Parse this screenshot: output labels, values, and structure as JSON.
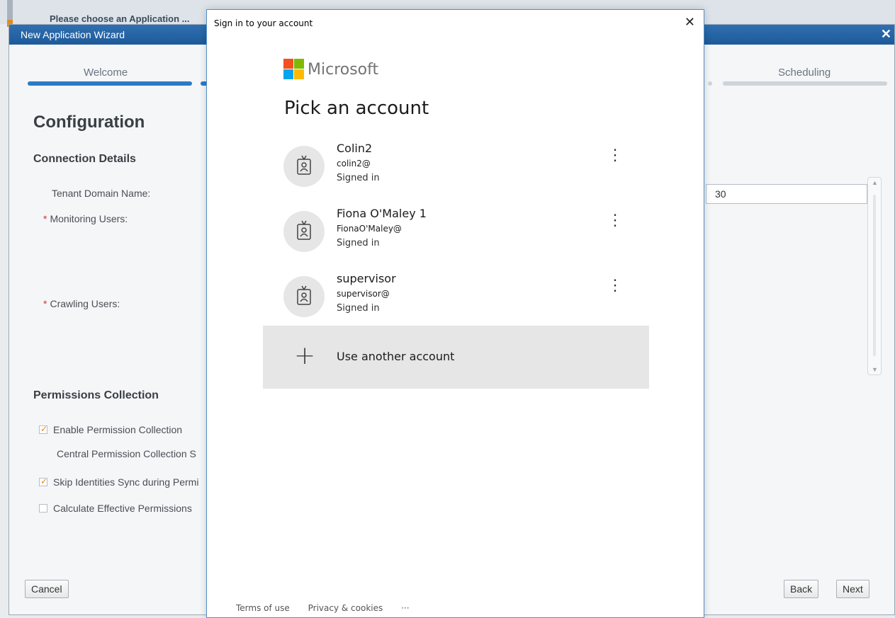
{
  "background": {
    "header_text": "Please choose an Application ..."
  },
  "wizard": {
    "title": "New Application Wizard",
    "close_glyph": "✕",
    "steps": {
      "welcome": "Welcome",
      "scheduling": "Scheduling"
    },
    "config_title": "Configuration",
    "connection_details": "Connection Details",
    "tenant_label": "Tenant Domain Name:",
    "monitoring_label": "Monitoring Users:",
    "crawling_label": "Crawling Users:",
    "required_mark": "*",
    "number_value": "30",
    "permissions_title": "Permissions Collection",
    "enable_permission": "Enable Permission Collection",
    "central_permission": "Central Permission Collection S",
    "skip_identities": "Skip Identities Sync during Permi",
    "calc_effective": "Calculate Effective Permissions",
    "cancel": "Cancel",
    "back": "Back",
    "next": "Next"
  },
  "signin": {
    "title": "Sign in to your account",
    "close_glyph": "✕",
    "brand": "Microsoft",
    "heading": "Pick an account",
    "accounts": [
      {
        "name": "Colin2",
        "email": "colin2@",
        "status": "Signed in"
      },
      {
        "name": "Fiona O'Maley 1",
        "email": "FionaO'Maley@",
        "status": "Signed in"
      },
      {
        "name": "supervisor",
        "email": "supervisor@",
        "status": "Signed in"
      }
    ],
    "more_glyph": "⋮",
    "use_another": "Use another account",
    "plus_glyph": "+",
    "terms": "Terms of use",
    "privacy": "Privacy & cookies",
    "ellipsis": "···"
  },
  "colors": {
    "titlebar": "#1e5a99",
    "progress_blue": "#2a7cc7",
    "ms_red": "#f25022",
    "ms_green": "#7fba00",
    "ms_blue": "#00a4ef",
    "ms_yellow": "#ffb900"
  },
  "icons": [
    "close-icon",
    "contact-badge-icon",
    "more-options-icon",
    "plus-icon",
    "checkbox-icon",
    "microsoft-logo"
  ]
}
